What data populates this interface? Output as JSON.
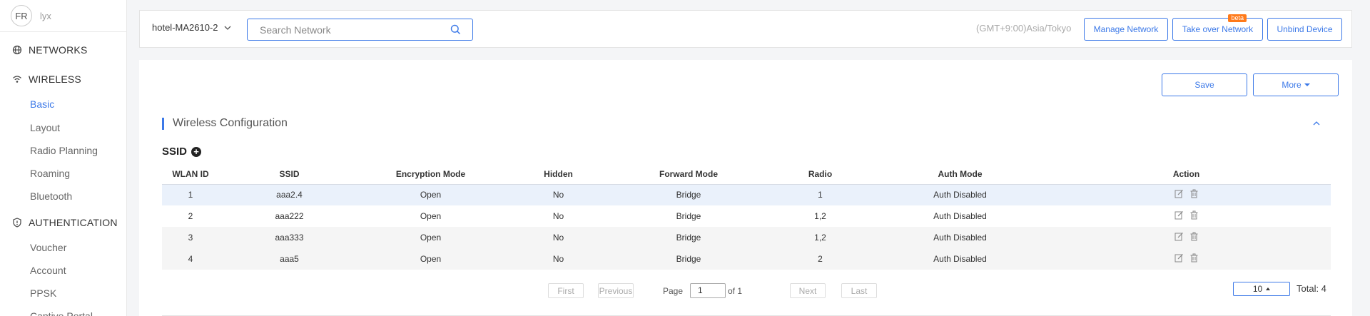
{
  "user": {
    "avatar_text": "FR",
    "name": "lyx"
  },
  "sidebar": {
    "sections": [
      {
        "label": "NETWORKS",
        "icon": "globe-icon"
      },
      {
        "label": "WIRELESS",
        "icon": "wifi-icon"
      },
      {
        "label": "AUTHENTICATION",
        "icon": "shield-icon"
      }
    ],
    "wireless_items": [
      "Basic",
      "Layout",
      "Radio Planning",
      "Roaming",
      "Bluetooth"
    ],
    "auth_items": [
      "Voucher",
      "Account",
      "PPSK",
      "Captive Portal"
    ],
    "active_item": "Basic"
  },
  "header": {
    "network_name": "hotel-MA2610-2",
    "search_placeholder": "Search Network",
    "timezone": "(GMT+9:00)Asia/Tokyo",
    "manage_label": "Manage Network",
    "takeover_label": "Take over Network",
    "beta_label": "beta",
    "unbind_label": "Unbind Device"
  },
  "toolbar": {
    "save_label": "Save",
    "more_label": "More"
  },
  "section": {
    "title": "Wireless Configuration",
    "ssid_label": "SSID"
  },
  "table": {
    "columns": [
      "WLAN ID",
      "SSID",
      "Encryption Mode",
      "Hidden",
      "Forward Mode",
      "Radio",
      "Auth Mode",
      "Action"
    ],
    "rows": [
      [
        "1",
        "aaa2.4",
        "Open",
        "No",
        "Bridge",
        "1",
        "Auth Disabled"
      ],
      [
        "2",
        "aaa222",
        "Open",
        "No",
        "Bridge",
        "1,2",
        "Auth Disabled"
      ],
      [
        "3",
        "aaa333",
        "Open",
        "No",
        "Bridge",
        "1,2",
        "Auth Disabled"
      ],
      [
        "4",
        "aaa5",
        "Open",
        "No",
        "Bridge",
        "2",
        "Auth Disabled"
      ]
    ]
  },
  "pagination": {
    "first": "First",
    "previous": "Previous",
    "page_label": "Page",
    "page_value": "1",
    "of_label": "of 1",
    "next": "Next",
    "last": "Last",
    "page_size": "10",
    "total": "Total: 4"
  },
  "colors": {
    "accent": "#3c79e8",
    "beta": "#ff7a1a"
  }
}
